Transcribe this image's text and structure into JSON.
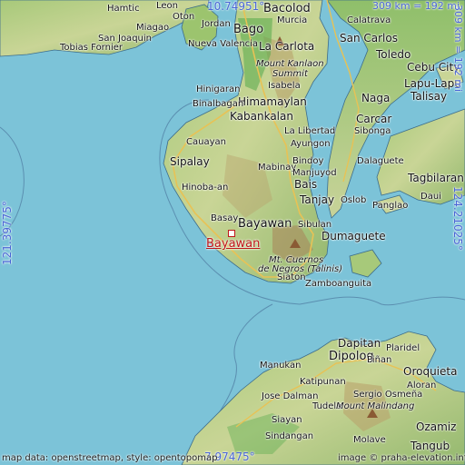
{
  "map": {
    "highlight": {
      "name": "Bayawan",
      "color": "#c0171a"
    },
    "coords": {
      "top": "10.74951°",
      "bottom": "7.97475°",
      "left": "121.39775°",
      "right": "124.21025°"
    },
    "scale": {
      "top": "309 km = 192 mi",
      "right": "309 km = 192 mi"
    },
    "attribution_left": "map data: openstreetmap, style: opentopomap",
    "attribution_right": "image © praha-elevation.info"
  },
  "places": [
    {
      "name": "Hamtic",
      "cls": "s10"
    },
    {
      "name": "Leon",
      "cls": "s10"
    },
    {
      "name": "Oton",
      "cls": "s10"
    },
    {
      "name": "Bacolod",
      "cls": "s13"
    },
    {
      "name": "Murcia",
      "cls": "s10"
    },
    {
      "name": "Calatrava",
      "cls": "s10"
    },
    {
      "name": "Miagao",
      "cls": "s10"
    },
    {
      "name": "Jordan",
      "cls": "s10"
    },
    {
      "name": "Bago",
      "cls": "s13"
    },
    {
      "name": "San Joaquin",
      "cls": "s10"
    },
    {
      "name": "Nueva Valencia",
      "cls": "s10"
    },
    {
      "name": "Tobias Fornier",
      "cls": "s10"
    },
    {
      "name": "La Carlota",
      "cls": "s12"
    },
    {
      "name": "San Carlos",
      "cls": "s12"
    },
    {
      "name": "Toledo",
      "cls": "s12"
    },
    {
      "name": "Cebu City",
      "cls": "s12"
    },
    {
      "name": "Mount Kanlaon",
      "cls": "s10 it"
    },
    {
      "name": "Summit",
      "cls": "s10 it"
    },
    {
      "name": "Lapu-Lapu",
      "cls": "s12"
    },
    {
      "name": "Isabela",
      "cls": "s10"
    },
    {
      "name": "Hinigaran",
      "cls": "s10"
    },
    {
      "name": "Talisay",
      "cls": "s12"
    },
    {
      "name": "Himamaylan",
      "cls": "s12"
    },
    {
      "name": "Naga",
      "cls": "s12"
    },
    {
      "name": "Binalbagan",
      "cls": "s10"
    },
    {
      "name": "Kabankalan",
      "cls": "s12"
    },
    {
      "name": "Carcar",
      "cls": "s12"
    },
    {
      "name": "La Libertad",
      "cls": "s10"
    },
    {
      "name": "Sibonga",
      "cls": "s10"
    },
    {
      "name": "Ayungon",
      "cls": "s10"
    },
    {
      "name": "Cauayan",
      "cls": "s10"
    },
    {
      "name": "Bindoy",
      "cls": "s10"
    },
    {
      "name": "Dalaguete",
      "cls": "s10"
    },
    {
      "name": "Sipalay",
      "cls": "s12"
    },
    {
      "name": "Mabinay",
      "cls": "s10"
    },
    {
      "name": "Manjuyod",
      "cls": "s10"
    },
    {
      "name": "Tagbilaran",
      "cls": "s12"
    },
    {
      "name": "Hinoba-an",
      "cls": "s10"
    },
    {
      "name": "Bais",
      "cls": "s12"
    },
    {
      "name": "Daui",
      "cls": "s10"
    },
    {
      "name": "Tanjay",
      "cls": "s12"
    },
    {
      "name": "Oslob",
      "cls": "s10"
    },
    {
      "name": "Panglao",
      "cls": "s10"
    },
    {
      "name": "Basay",
      "cls": "s10"
    },
    {
      "name": "Bayawan",
      "cls": "s13"
    },
    {
      "name": "Sibulan",
      "cls": "s10"
    },
    {
      "name": "Dumaguete",
      "cls": "s12"
    },
    {
      "name": "Mt. Cuernos",
      "cls": "s10 it"
    },
    {
      "name": "de Negros (Talinis)",
      "cls": "s10 it"
    },
    {
      "name": "Siaton",
      "cls": "s10"
    },
    {
      "name": "Zamboanguita",
      "cls": "s10"
    },
    {
      "name": "Dapitan",
      "cls": "s12"
    },
    {
      "name": "Dipolog",
      "cls": "s13"
    },
    {
      "name": "Piñan",
      "cls": "s10"
    },
    {
      "name": "Manukan",
      "cls": "s10"
    },
    {
      "name": "Oroquieta",
      "cls": "s12"
    },
    {
      "name": "Katipunan",
      "cls": "s10"
    },
    {
      "name": "Plaridel",
      "cls": "s10"
    },
    {
      "name": "Jose Dalman",
      "cls": "s10"
    },
    {
      "name": "Sergio Osmeña",
      "cls": "s10"
    },
    {
      "name": "Tudela",
      "cls": "s10"
    },
    {
      "name": "Aloran",
      "cls": "s10"
    },
    {
      "name": "Siayan",
      "cls": "s10"
    },
    {
      "name": "Mount Malindang",
      "cls": "s10 it"
    },
    {
      "name": "Ozamiz",
      "cls": "s12"
    },
    {
      "name": "Sindangan",
      "cls": "s10"
    },
    {
      "name": "Molave",
      "cls": "s10"
    },
    {
      "name": "Tangub",
      "cls": "s12"
    }
  ]
}
